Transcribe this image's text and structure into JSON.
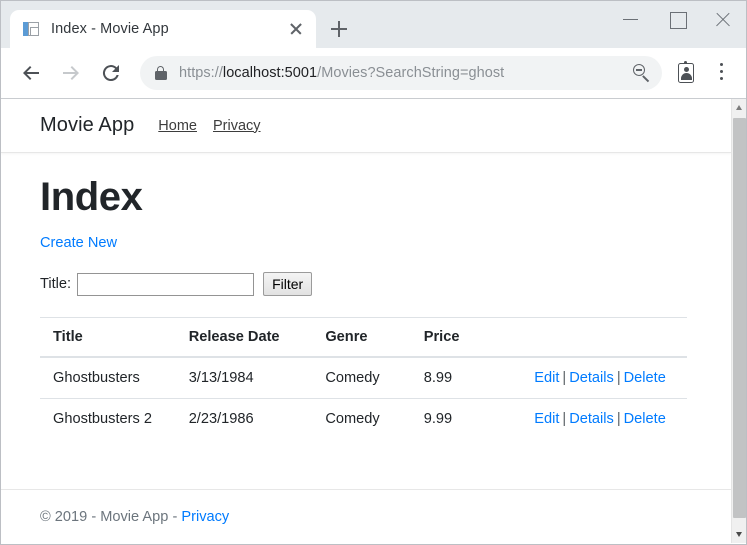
{
  "browser": {
    "tab": {
      "title": "Index - Movie App",
      "favicon": "page-document-icon",
      "close_icon": "close-icon"
    },
    "new_tab_label": "+",
    "window_controls": {
      "minimize": "minimize-icon",
      "maximize": "maximize-icon",
      "close": "close-icon"
    },
    "nav": {
      "back": "back-arrow-icon",
      "forward": "forward-arrow-icon",
      "reload": "reload-icon"
    },
    "omnibox": {
      "lock_icon": "lock-icon",
      "url_scheme": "https://",
      "url_host": "localhost:5001",
      "url_path": "/Movies?SearchString=ghost",
      "url_full": "https://localhost:5001/Movies?SearchString=ghost",
      "zoom_out_icon": "zoom-out-magnifier-icon"
    },
    "toolbar_icons": {
      "profile": "profile-badge-icon",
      "menu": "three-dot-menu-icon"
    }
  },
  "site": {
    "navbar": {
      "brand": "Movie App",
      "links": [
        {
          "label": "Home"
        },
        {
          "label": "Privacy"
        }
      ]
    },
    "main": {
      "title": "Index",
      "create_new_label": "Create New",
      "filter": {
        "label": "Title:",
        "value": "",
        "placeholder": "",
        "button_label": "Filter"
      },
      "table": {
        "columns": [
          "Title",
          "Release Date",
          "Genre",
          "Price"
        ],
        "rows": [
          {
            "title": "Ghostbusters",
            "release_date": "3/13/1984",
            "genre": "Comedy",
            "price": "8.99",
            "actions": {
              "edit": "Edit",
              "details": "Details",
              "delete": "Delete"
            }
          },
          {
            "title": "Ghostbusters 2",
            "release_date": "2/23/1986",
            "genre": "Comedy",
            "price": "9.99",
            "actions": {
              "edit": "Edit",
              "details": "Details",
              "delete": "Delete"
            }
          }
        ],
        "action_separator": "|"
      }
    },
    "footer": {
      "copyright": "© 2019 - Movie App -",
      "privacy_label": "Privacy"
    }
  },
  "colors": {
    "link": "#007bff",
    "text": "#212529",
    "muted": "#6c757d",
    "chrome_bg": "#e6eaed",
    "omnibox_bg": "#f1f3f4"
  }
}
